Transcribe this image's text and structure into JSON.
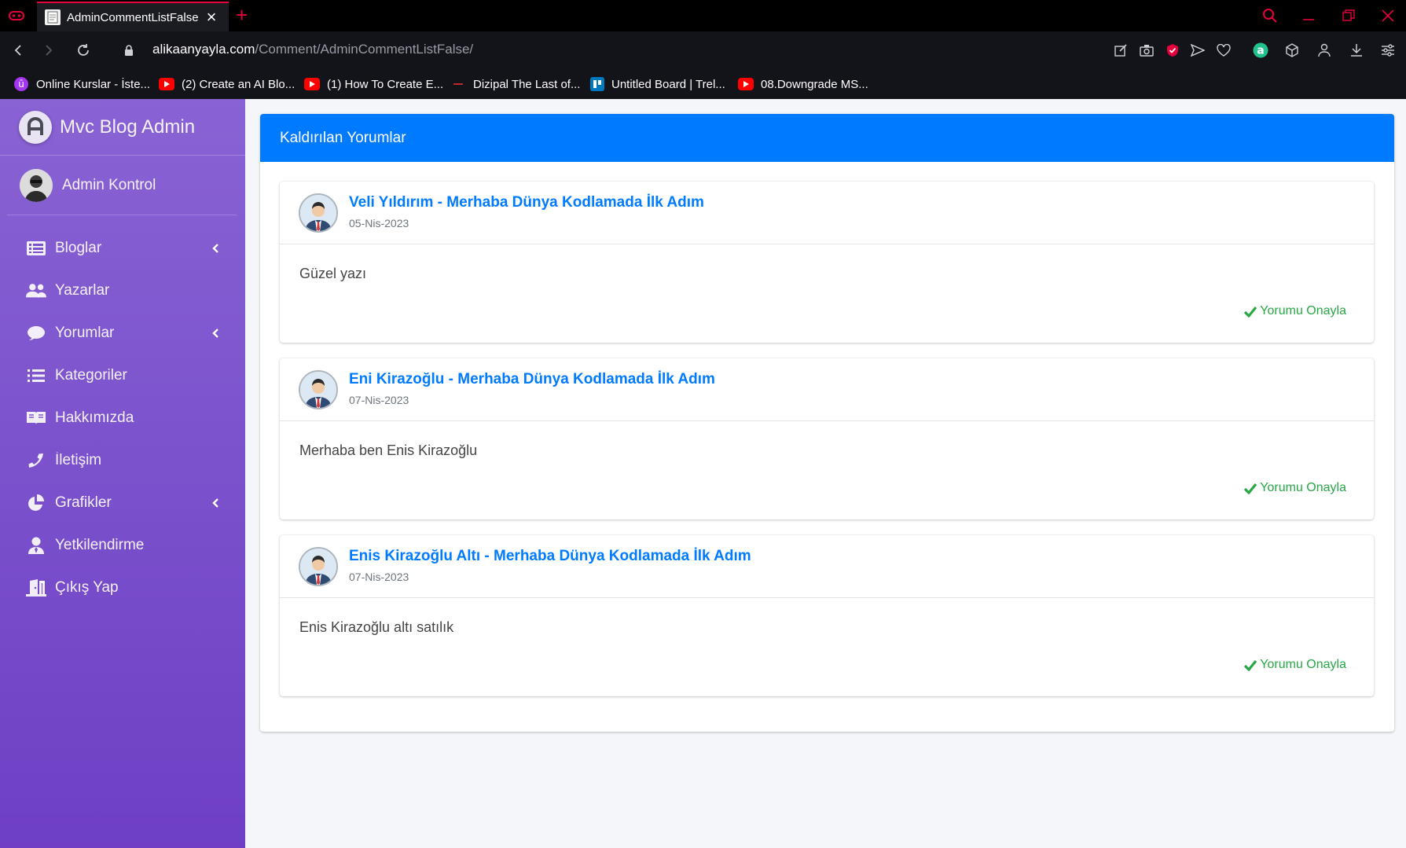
{
  "browser": {
    "tab_title": "AdminCommentListFalse",
    "url_host": "alikaanyayla.com",
    "url_path": "/Comment/AdminCommentListFalse/",
    "bookmarks": [
      {
        "label": "Online Kurslar - İste..."
      },
      {
        "label": "(2) Create an AI Blo..."
      },
      {
        "label": "(1) How To Create E..."
      },
      {
        "label": "Dizipal The Last of..."
      },
      {
        "label": "Untitled Board | Trel..."
      },
      {
        "label": "08.Downgrade MS..."
      }
    ]
  },
  "sidebar": {
    "brand": "Mvc Blog Admin",
    "user": "Admin Kontrol",
    "items": [
      {
        "label": "Bloglar",
        "icon": "list-alt-icon"
      },
      {
        "label": "Yazarlar",
        "icon": "users-icon"
      },
      {
        "label": "Yorumlar",
        "icon": "comment-icon"
      },
      {
        "label": "Kategoriler",
        "icon": "list-icon"
      },
      {
        "label": "Hakkımızda",
        "icon": "book-open-icon"
      },
      {
        "label": "İletişim",
        "icon": "phone-icon"
      },
      {
        "label": "Grafikler",
        "icon": "chart-pie-icon"
      },
      {
        "label": "Yetkilendirme",
        "icon": "user-tie-icon"
      },
      {
        "label": "Çıkış Yap",
        "icon": "door-open-icon"
      }
    ]
  },
  "main": {
    "card_title": "Kaldırılan Yorumlar",
    "comments": [
      {
        "title": "Veli Yıldırım - Merhaba Dünya Kodlamada İlk Adım",
        "date": "05-Nis-2023",
        "body": "Güzel yazı",
        "action": "Yorumu Onayla"
      },
      {
        "title": "Eni Kirazoğlu - Merhaba Dünya Kodlamada İlk Adım",
        "date": "07-Nis-2023",
        "body": "Merhaba ben Enis Kirazoğlu",
        "action": "Yorumu Onayla"
      },
      {
        "title": "Enis Kirazoğlu Altı - Merhaba Dünya Kodlamada İlk Adım",
        "date": "07-Nis-2023",
        "body": "Enis Kirazoğlu altı satılık",
        "action": "Yorumu Onayla"
      }
    ]
  },
  "colors": {
    "primary": "#007bff",
    "success": "#28a745",
    "sidebar_top": "#8963d4",
    "sidebar_bottom": "#6e3fc4",
    "opera_red": "#e4003a"
  }
}
